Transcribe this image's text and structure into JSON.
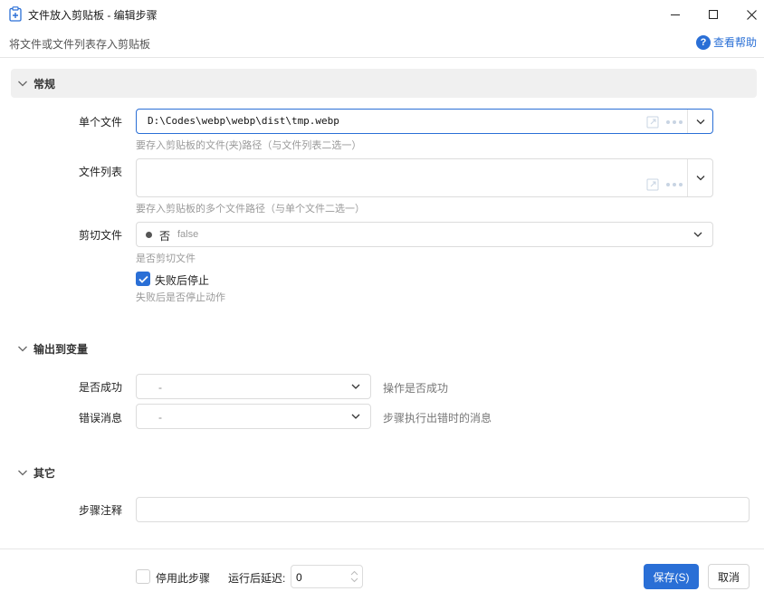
{
  "window": {
    "title": "文件放入剪贴板 - 编辑步骤",
    "description": "将文件或文件列表存入剪贴板",
    "help_label": "查看帮助",
    "help_icon": "question-circle-icon"
  },
  "sections": {
    "general": "常规",
    "output": "输出到变量",
    "other": "其它"
  },
  "fields": {
    "single_file": {
      "label": "单个文件",
      "value": "D:\\Codes\\webp\\webp\\dist\\tmp.webp",
      "hint": "要存入剪贴板的文件(夹)路径（与文件列表二选一）"
    },
    "file_list": {
      "label": "文件列表",
      "value": "",
      "hint": "要存入剪贴板的多个文件路径（与单个文件二选一）"
    },
    "cut_file": {
      "label": "剪切文件",
      "value_cn": "否",
      "value_en": "false",
      "hint": "是否剪切文件"
    },
    "stop_on_fail": {
      "label": "失败后停止",
      "checked": true,
      "hint": "失败后是否停止动作"
    },
    "is_success": {
      "label": "是否成功",
      "value": "-",
      "note": "操作是否成功"
    },
    "error_message": {
      "label": "错误消息",
      "value": "-",
      "note": "步骤执行出错时的消息"
    },
    "step_comment": {
      "label": "步骤注释",
      "value": ""
    }
  },
  "footer": {
    "disable_label": "停用此步骤",
    "disable_checked": false,
    "delay_label": "运行后延迟:",
    "delay_value": "0",
    "save_label": "保存(S)",
    "cancel_label": "取消"
  },
  "colors": {
    "accent": "#2a6fd6",
    "section_bg": "#f0f0f0",
    "hint": "#9a9a9a"
  }
}
